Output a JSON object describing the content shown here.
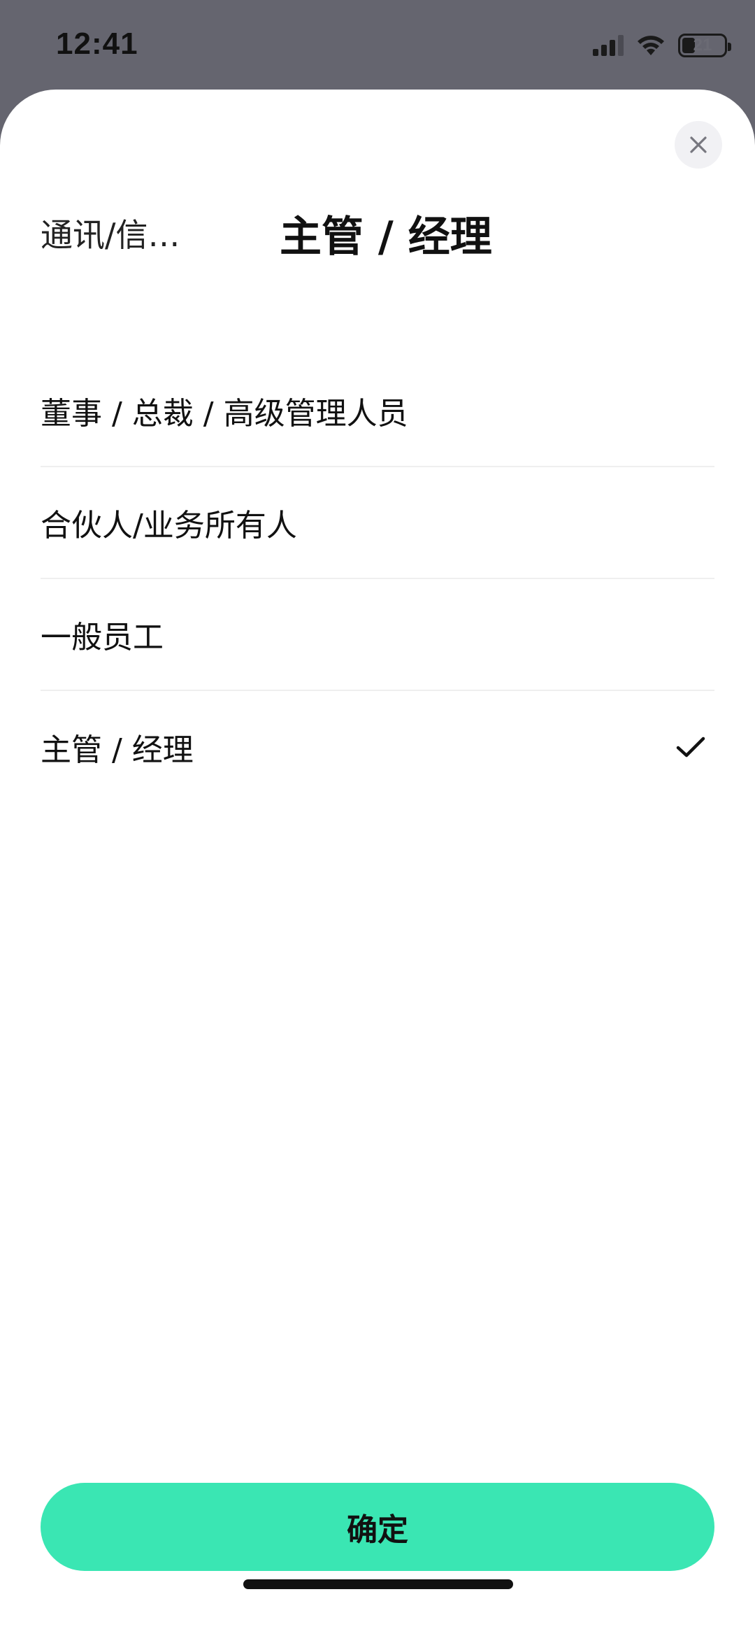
{
  "status_bar": {
    "time": "12:41",
    "battery_level": "21",
    "icons": [
      "signal-icon",
      "wifi-icon",
      "battery-icon"
    ]
  },
  "sheet": {
    "close_icon": "close-icon",
    "breadcrumb": {
      "parent": "通讯/信…",
      "current": "主管 / 经理"
    },
    "options": [
      {
        "label": "董事 / 总裁 / 高级管理人员",
        "selected": false
      },
      {
        "label": "合伙人/业务所有人",
        "selected": false
      },
      {
        "label": "一般员工",
        "selected": false
      },
      {
        "label": "主管 / 经理",
        "selected": true
      }
    ],
    "confirm_label": "确定"
  },
  "colors": {
    "accent": "#3ae6b3",
    "backdrop": "#65656f",
    "divider": "#efefef"
  }
}
